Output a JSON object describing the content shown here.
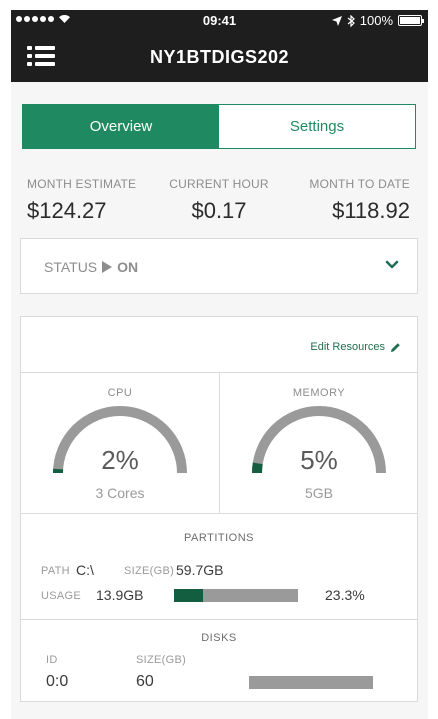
{
  "status_bar": {
    "time": "09:41",
    "battery": "100%",
    "icons": [
      "signal-dots-icon",
      "wifi-icon",
      "location-arrow-icon",
      "bluetooth-icon",
      "battery-icon"
    ]
  },
  "header": {
    "title": "NY1BTDIGS202",
    "menu_icon": "list-menu-icon"
  },
  "tabs": [
    {
      "label": "Overview",
      "active": true
    },
    {
      "label": "Settings",
      "active": false
    }
  ],
  "costs": {
    "month_estimate": {
      "label": "MONTH ESTIMATE",
      "value": "$124.27"
    },
    "current_hour": {
      "label": "CURRENT HOUR",
      "value": "$0.17"
    },
    "month_to_date": {
      "label": "MONTH TO DATE",
      "value": "$118.92"
    }
  },
  "status": {
    "label": "STATUS",
    "value": "ON",
    "expand_icon": "chevron-down-icon"
  },
  "resources": {
    "edit_label": "Edit Resources",
    "edit_icon": "pencil-icon",
    "cpu": {
      "label": "CPU",
      "percent_text": "2%",
      "percent": 2,
      "detail": "3 Cores"
    },
    "memory": {
      "label": "MEMORY",
      "percent_text": "5%",
      "percent": 5,
      "detail": "5GB"
    },
    "partitions": {
      "title": "PARTITIONS",
      "path_label": "PATH",
      "path_value": "C:\\",
      "size_label": "SIZE(GB)",
      "size_value": "59.7GB",
      "usage_label": "USAGE",
      "usage_value": "13.9GB",
      "usage_percent_text": "23.3%",
      "usage_percent": 23.3
    },
    "disks": {
      "title": "DISKS",
      "id_label": "ID",
      "id_value": "0:0",
      "size_label": "SIZE(GB)",
      "size_value": "60",
      "usage_percent": 0
    }
  },
  "colors": {
    "accent": "#1f8a61",
    "gauge_fill": "#135e40",
    "gauge_track": "#9a9a9a",
    "header_bg": "#1e1e1e"
  }
}
